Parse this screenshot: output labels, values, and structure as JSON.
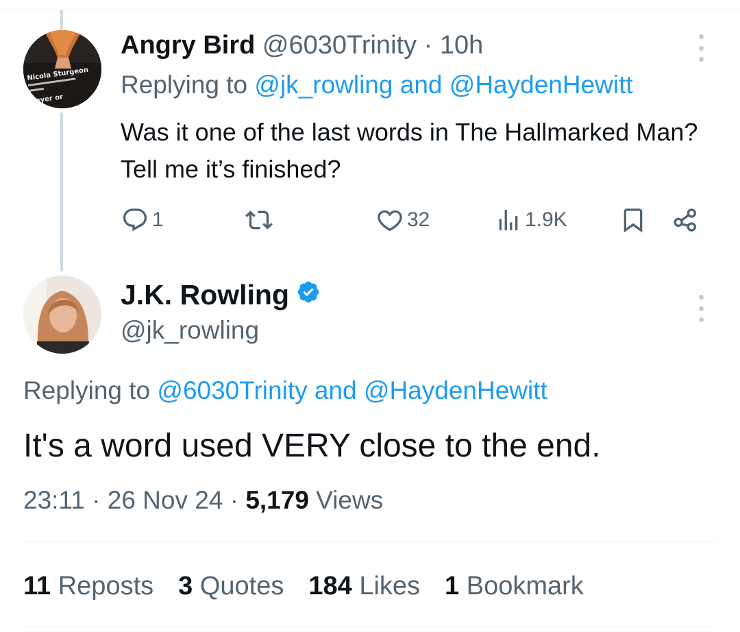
{
  "tweet_reply": {
    "author_name": "Angry Bird",
    "author_handle": "@6030Trinity",
    "separator": " · ",
    "time": "10h",
    "replying_prefix": "Replying to ",
    "replying_to_1": "@jk_rowling",
    "replying_and": " and ",
    "replying_to_2": "@HaydenHewitt",
    "text": "Was it one of the last words in The Hallmarked Man? Tell me it’s finished?",
    "avatar_shirt_text_1": "Nicola Sturgeon",
    "avatar_shirt_text_2": "troyer or",
    "actions": {
      "reply_icon": "reply-icon",
      "reply_count": "1",
      "repost_icon": "repost-icon",
      "like_icon": "heart-icon",
      "like_count": "32",
      "views_icon": "views-chart-icon",
      "views_count": "1.9K",
      "bookmark_icon": "bookmark-icon",
      "share_icon": "share-icon"
    }
  },
  "tweet_main": {
    "author_name": "J.K. Rowling",
    "verified_icon": "verified-badge-icon",
    "author_handle": "@jk_rowling",
    "replying_prefix": "Replying to ",
    "replying_to_1": "@6030Trinity",
    "replying_and": " and ",
    "replying_to_2": "@HaydenHewitt",
    "text": "It's a word used VERY close to the end.",
    "time": "23:11",
    "sep": " · ",
    "date": "26 Nov 24",
    "views_number": "5,179",
    "views_label": " Views"
  },
  "stats": {
    "reposts_count": "11",
    "reposts_label": " Reposts",
    "quotes_count": "3",
    "quotes_label": " Quotes",
    "likes_count": "184",
    "likes_label": " Likes",
    "bookmarks_count": "1",
    "bookmarks_label": " Bookmark"
  },
  "colors": {
    "link": "#1d9bf0",
    "secondary_text": "#536471",
    "primary_text": "#0f1419",
    "verified": "#1d9bf0",
    "thread_line": "#cfd9de"
  }
}
